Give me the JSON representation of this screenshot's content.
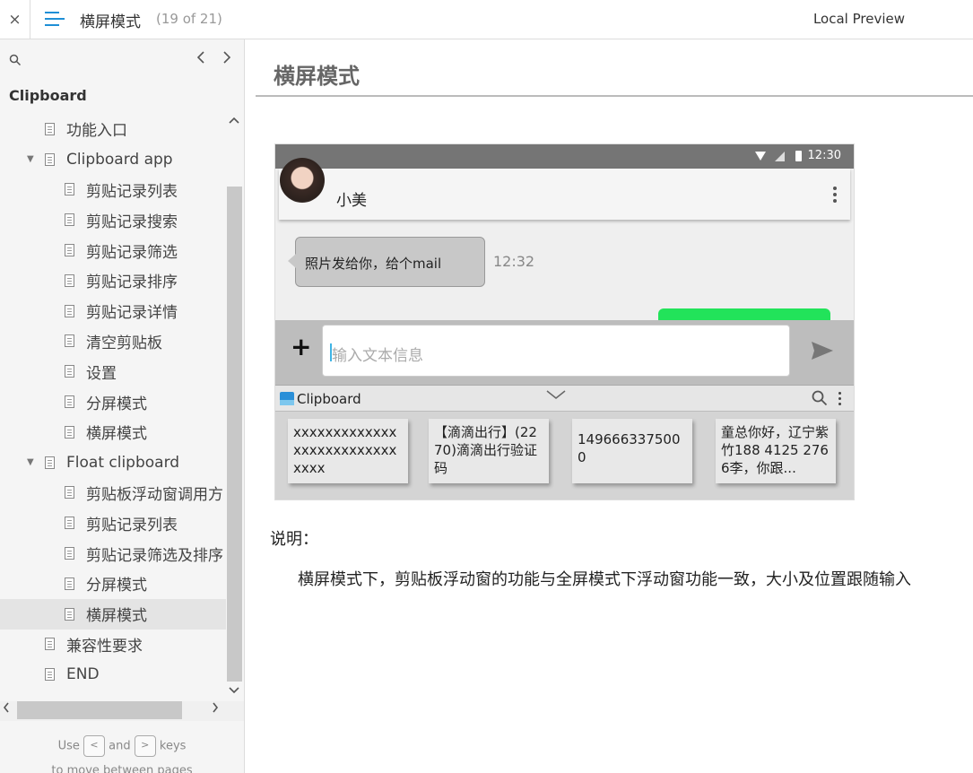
{
  "topbar": {
    "close_icon": "×",
    "title": "横屏模式",
    "count": "(19 of 21)",
    "local_preview": "Local Preview"
  },
  "sidebar": {
    "section_title": "Clipboard",
    "items": [
      {
        "label": "功能入口",
        "level": 1,
        "expandable": false,
        "active": false
      },
      {
        "label": "Clipboard app",
        "level": 1,
        "expandable": true,
        "active": false
      },
      {
        "label": "剪贴记录列表",
        "level": 2,
        "expandable": false,
        "active": false
      },
      {
        "label": "剪贴记录搜索",
        "level": 2,
        "expandable": false,
        "active": false
      },
      {
        "label": "剪贴记录筛选",
        "level": 2,
        "expandable": false,
        "active": false
      },
      {
        "label": "剪贴记录排序",
        "level": 2,
        "expandable": false,
        "active": false
      },
      {
        "label": "剪贴记录详情",
        "level": 2,
        "expandable": false,
        "active": false
      },
      {
        "label": "清空剪贴板",
        "level": 2,
        "expandable": false,
        "active": false
      },
      {
        "label": "设置",
        "level": 2,
        "expandable": false,
        "active": false
      },
      {
        "label": "分屏模式",
        "level": 2,
        "expandable": false,
        "active": false
      },
      {
        "label": "横屏模式",
        "level": 2,
        "expandable": false,
        "active": false
      },
      {
        "label": "Float clipboard",
        "level": 1,
        "expandable": true,
        "active": false
      },
      {
        "label": "剪贴板浮动窗调用方",
        "level": 2,
        "expandable": false,
        "active": false
      },
      {
        "label": "剪贴记录列表",
        "level": 2,
        "expandable": false,
        "active": false
      },
      {
        "label": "剪贴记录筛选及排序",
        "level": 2,
        "expandable": false,
        "active": false
      },
      {
        "label": "分屏模式",
        "level": 2,
        "expandable": false,
        "active": false
      },
      {
        "label": "横屏模式",
        "level": 2,
        "expandable": false,
        "active": true
      },
      {
        "label": "兼容性要求",
        "level": 1,
        "expandable": false,
        "active": false
      },
      {
        "label": "END",
        "level": 1,
        "expandable": false,
        "active": false
      }
    ],
    "hint": {
      "use": "Use",
      "and": "and",
      "keys": "keys",
      "prev_key": "<",
      "next_key": ">",
      "line2": "to move between pages"
    }
  },
  "content": {
    "heading": "横屏模式",
    "phone": {
      "status_time": "12:30",
      "contact_name": "小美",
      "message": "照片发给你，给个mail",
      "message_time": "12:32",
      "input_placeholder": "输入文本信息",
      "clipboard_label": "Clipboard",
      "cards": [
        "xxxxxxxxxxxxxxxxxxxxxxxxxxxxxx",
        "【滴滴出行】(2270)滴滴出行验证码",
        "1496663375000",
        "童总你好，辽宁紫竹188 4125 2766李，你跟..."
      ]
    },
    "note_label": "说明：",
    "note_text": "横屏模式下，剪贴板浮动窗的功能与全屏模式下浮动窗功能一致，大小及位置跟随输入"
  },
  "colors": {
    "accent": "#1f8fd6",
    "status_bar": "#757575",
    "green_bubble": "#22e35a"
  }
}
